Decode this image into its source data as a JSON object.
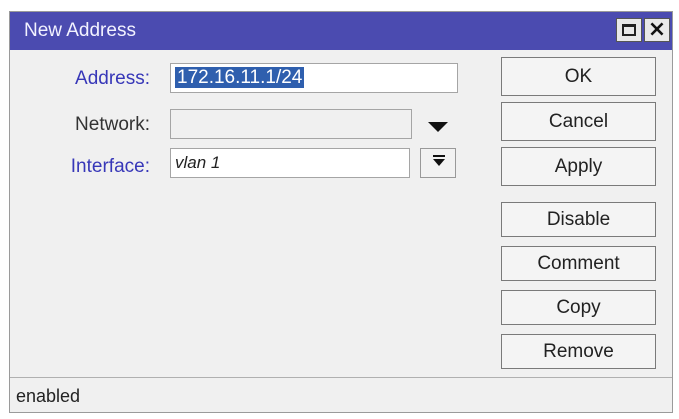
{
  "window": {
    "title": "New Address"
  },
  "form": {
    "address_label": "Address:",
    "address_value": "172.16.11.1/24",
    "network_label": "Network:",
    "network_value": "",
    "interface_label": "Interface:",
    "interface_value": "vlan 1"
  },
  "buttons": {
    "ok": "OK",
    "cancel": "Cancel",
    "apply": "Apply",
    "disable": "Disable",
    "comment": "Comment",
    "copy": "Copy",
    "remove": "Remove"
  },
  "status": {
    "text": "enabled"
  },
  "colors": {
    "titlebar": "#4b4bb0",
    "label_accent": "#3737b8",
    "selection": "#2f5fae"
  },
  "icons": {
    "maximize": "maximize-icon",
    "close": "close-icon",
    "network_dropdown": "triangle-down-icon",
    "interface_dropdown": "combo-arrow-icon"
  }
}
